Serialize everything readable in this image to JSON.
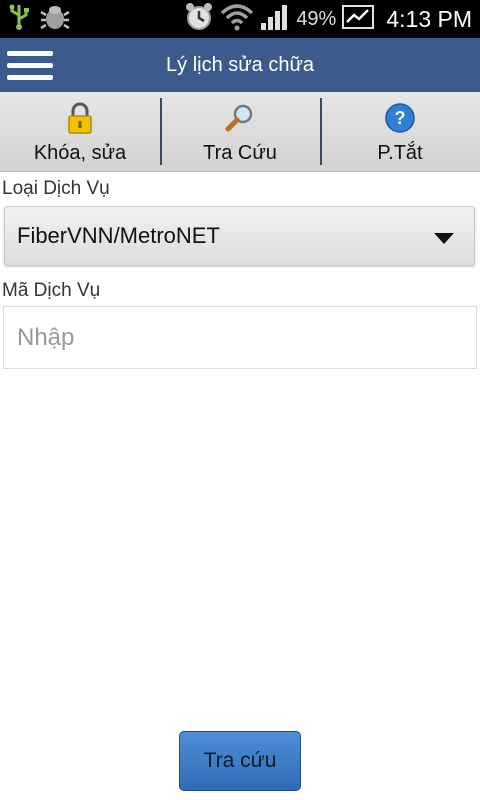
{
  "status_bar": {
    "battery_percent": "49%",
    "time": "4:13 PM",
    "icons": [
      "usb-icon",
      "debug-bug-icon",
      "alarm-clock-icon",
      "wifi-icon",
      "signal-bars-icon",
      "battery-icon"
    ]
  },
  "header": {
    "title": "Lý lịch sửa chữa",
    "menu_icon": "hamburger-menu-icon",
    "background": "#3c5a8c"
  },
  "toolbar": {
    "items": [
      {
        "label": "Khóa, sửa",
        "icon": "padlock-icon"
      },
      {
        "label": "Tra Cứu",
        "icon": "magnifier-icon"
      },
      {
        "label": "P.Tắt",
        "icon": "help-question-icon"
      }
    ]
  },
  "form": {
    "service_type_label": "Loại Dịch Vụ",
    "service_type_value": "FiberVNN/MetroNET",
    "service_code_label": "Mã Dịch Vụ",
    "service_code_placeholder": "Nhập",
    "service_code_value": ""
  },
  "actions": {
    "search_label": "Tra cứu",
    "accent": "#3a78c4"
  }
}
